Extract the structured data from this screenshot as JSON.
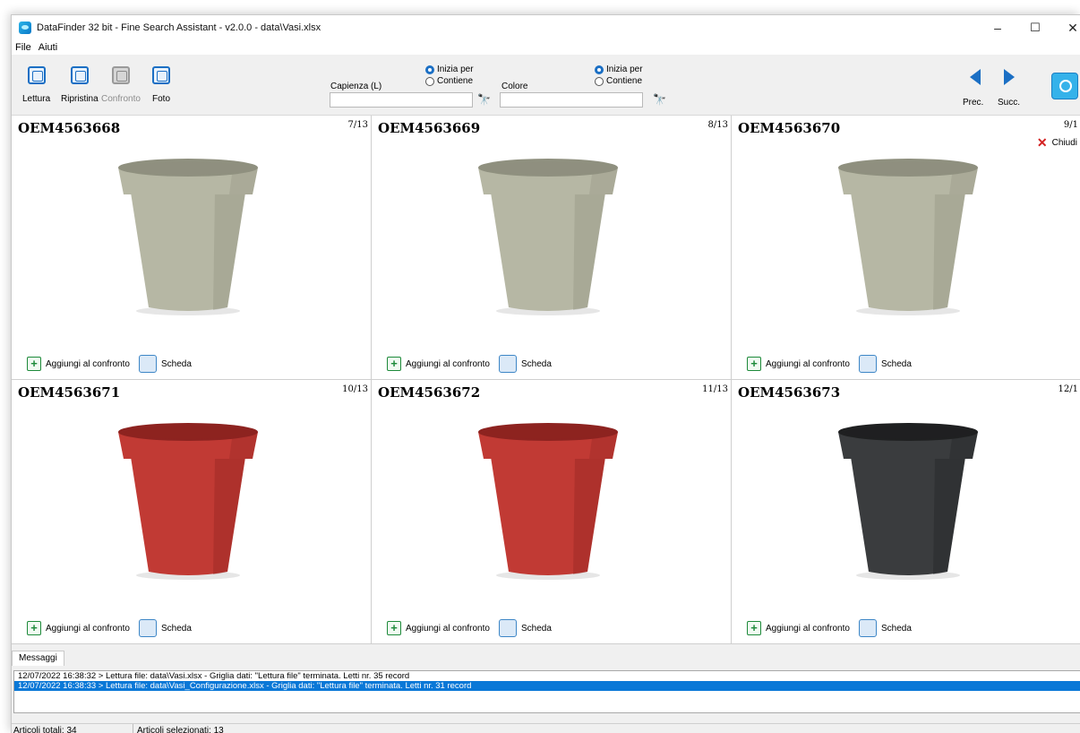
{
  "window": {
    "title": "DataFinder 32 bit - Fine Search Assistant - v2.0.0 - data\\Vasi.xlsx",
    "minimize": "–",
    "maximize": "☐",
    "close": "✕"
  },
  "menu": [
    "File",
    "Aiuti"
  ],
  "toolbar": {
    "lettura": "Lettura",
    "ripristina": "Ripristina",
    "confronto": "Confronto",
    "foto": "Foto",
    "field1_label": "Capienza (L)",
    "field2_label": "Colore",
    "radio_start": "Inizia per",
    "radio_contains": "Contiene",
    "prev": "Prec.",
    "next": "Succ."
  },
  "cards": [
    {
      "code": "OEM4563668",
      "pos": "7/13",
      "color": "#b6b7a4",
      "shade": "#8f907f"
    },
    {
      "code": "OEM4563669",
      "pos": "8/13",
      "color": "#b6b7a4",
      "shade": "#8f907f"
    },
    {
      "code": "OEM4563670",
      "pos": "9/1",
      "color": "#b6b7a4",
      "shade": "#8f907f"
    },
    {
      "code": "OEM4563671",
      "pos": "10/13",
      "color": "#c13a34",
      "shade": "#8d2320"
    },
    {
      "code": "OEM4563672",
      "pos": "11/13",
      "color": "#c13a34",
      "shade": "#8d2320"
    },
    {
      "code": "OEM4563673",
      "pos": "12/1",
      "color": "#3a3c3e",
      "shade": "#1f2021"
    }
  ],
  "card_actions": {
    "add": "Aggiungi al confronto",
    "sheet": "Scheda",
    "close": "Chiudi"
  },
  "messages": {
    "tab": "Messaggi",
    "lines": [
      "12/07/2022 16:38:32 > Lettura file: data\\Vasi.xlsx - Griglia dati: \"Lettura file\" terminata. Letti nr. 35 record",
      "12/07/2022 16:38:33 > Lettura file: data\\Vasi_Configurazione.xlsx - Griglia dati: \"Lettura file\" terminata. Letti nr. 31 record"
    ]
  },
  "status": {
    "total": "Articoli totali: 34",
    "selected": "Articoli selezionati: 13"
  }
}
